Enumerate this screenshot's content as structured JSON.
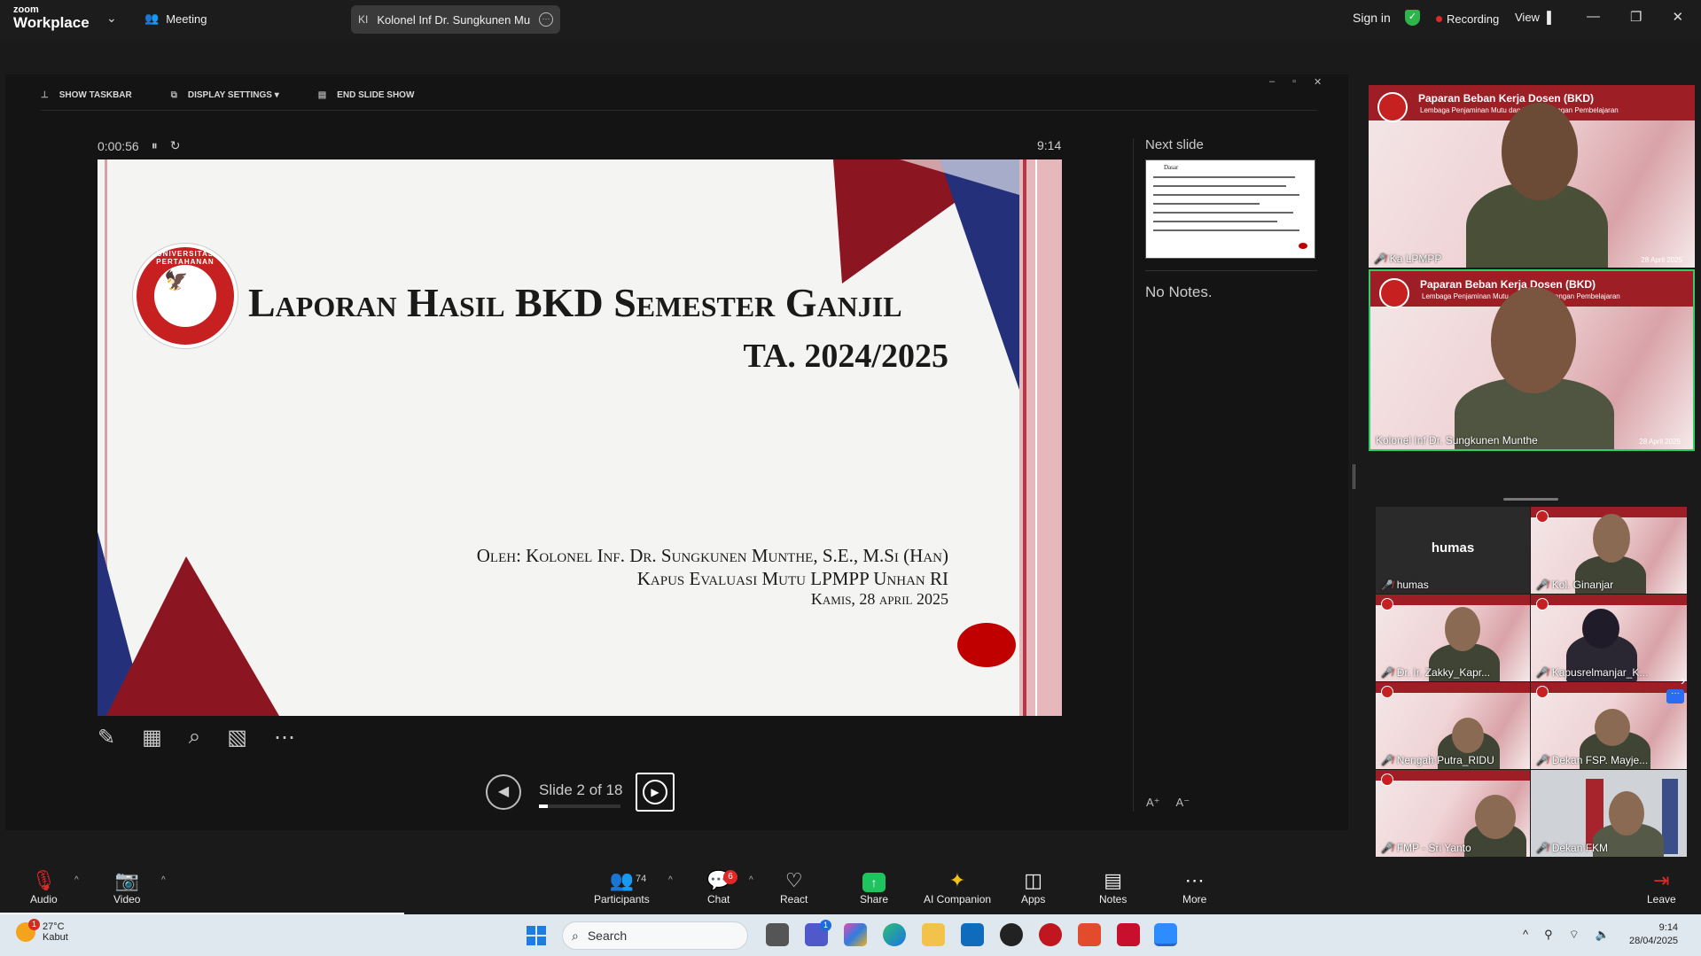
{
  "topbar": {
    "logo_line1": "zoom",
    "logo_line2": "Workplace",
    "meeting_label": "Meeting",
    "tab_initials": "KI",
    "tab_title": "Kolonel Inf Dr. Sungkunen Muntl",
    "signin": "Sign in",
    "recording": "Recording",
    "view": "View"
  },
  "presentation": {
    "toolbar": [
      "SHOW TASKBAR",
      "DISPLAY SETTINGS ▾",
      "END SLIDE SHOW"
    ],
    "elapsed": "0:00:56",
    "clock": "9:14",
    "slide_counter": "Slide 2 of 18",
    "progress": 0.11,
    "next_slide_label": "Next slide",
    "next_slide_title": "Dasar",
    "notes": "No Notes."
  },
  "slide": {
    "title_line1": "Laporan Hasil BKD Semester Ganjil",
    "title_line2": "TA. 2024/2025",
    "byline1": "Oleh:  Kolonel Inf. Dr. Sungkunen Munthe, S.E., M.Si (Han)",
    "byline2": "Kapus Evaluasi Mutu LPMPP Unhan RI",
    "byline3": "Kamis, 28 april 2025",
    "emblem_text": "UNIVERSITAS PERTAHANAN"
  },
  "videos": {
    "speakers": [
      {
        "name": "Ka LPMPP",
        "banner": "Paparan Beban Kerja Dosen (BKD)",
        "banner_sub": "Lembaga Penjaminan Mutu dan Pengembangan Pembelajaran",
        "date": "28 April 2025"
      },
      {
        "name": "Kolonel Inf Dr. Sungkunen Munthe",
        "banner": "Paparan Beban Kerja Dosen (BKD)",
        "banner_sub": "Lembaga Penjaminan Mutu dan Pengembangan Pembelajaran",
        "date": "28 April 2025"
      }
    ],
    "grid": [
      {
        "name": "humas"
      },
      {
        "name": "Kol. Ginanjar"
      },
      {
        "name": "Dr. Ir. Zakky_Kapr..."
      },
      {
        "name": "Kapusrelmanjar_K..."
      },
      {
        "name": "Nengah Putra_RIDU"
      },
      {
        "name": "Dekan FSP. Mayje..."
      },
      {
        "name": "FMP - Sri Yanto"
      },
      {
        "name": "Dekan FKM"
      }
    ],
    "humas_label": "humas"
  },
  "toolbar": {
    "audio": "Audio",
    "video": "Video",
    "participants": "Participants",
    "participants_count": "74",
    "chat": "Chat",
    "chat_badge": "6",
    "react": "React",
    "share": "Share",
    "ai_companion": "AI Companion",
    "apps": "Apps",
    "notes": "Notes",
    "more": "More",
    "leave": "Leave"
  },
  "taskbar": {
    "weather_temp": "27°C",
    "weather_desc": "Kabut",
    "weather_badge": "1",
    "search_placeholder": "Search",
    "time": "9:14",
    "date": "28/04/2025",
    "teams_badge": "1"
  },
  "colors": {
    "slide_red": "#8b1520",
    "slide_blue": "#24307a",
    "recording_dot": "#e02828",
    "share_green": "#1ec45e",
    "active_speaker_border": "#2ed06a"
  }
}
